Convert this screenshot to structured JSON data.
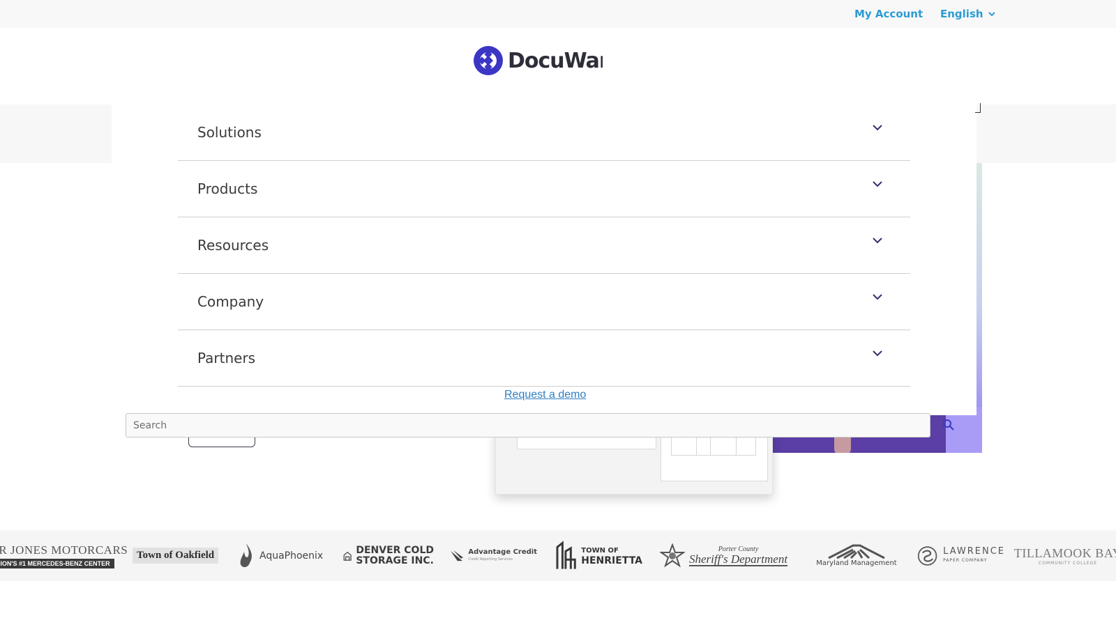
{
  "topbar": {
    "my_account": "My Account",
    "language": "English"
  },
  "header": {
    "logo_text": "DocuWare"
  },
  "menu": {
    "items": [
      {
        "label": "Solutions"
      },
      {
        "label": "Products"
      },
      {
        "label": "Resources"
      },
      {
        "label": "Company"
      },
      {
        "label": "Partners"
      }
    ],
    "demo_link": "Request a demo"
  },
  "search": {
    "placeholder": "Search"
  },
  "clients": {
    "c1_name": "HER JONES MOTORCARS",
    "c1_tag": "ION'S #1 MERCEDES-BENZ CENTER",
    "c2_name": "Town of Oakfield",
    "c3_name": "AquaPhoenix",
    "c4_line1": "DENVER COLD",
    "c4_line2": "STORAGE INC.",
    "c5_name": "Advantage Credit",
    "c5_sub": "Credit Reporting Services",
    "c6_line1": "TOWN OF",
    "c6_line2": "HENRIETTA",
    "c7_line1": "Porter County",
    "c7_line2": "Sheriff's Department",
    "c8_name": "Maryland Management",
    "c9_line1": "LAWRENCE",
    "c9_line2": "PAPER COMPANY",
    "c10_name": "TILLAMOOK BAY",
    "c10_sub": "COMMUNITY COLLEGE"
  },
  "colors": {
    "link_blue": "#2b9bd3",
    "brand_indigo": "#3b36c4",
    "text_dark": "#3a3a3a"
  }
}
